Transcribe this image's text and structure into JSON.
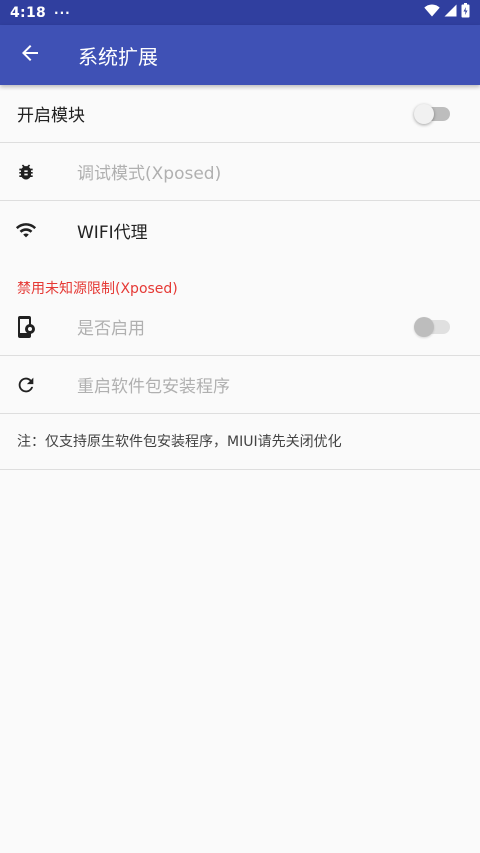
{
  "status_bar": {
    "time": "4:18",
    "dots": "···",
    "icons": [
      "wifi-icon",
      "signal-icon",
      "battery-icon"
    ]
  },
  "app_bar": {
    "title": "系统扩展",
    "back_icon": "arrow-back-icon"
  },
  "settings": {
    "enable_module": {
      "label": "开启模块",
      "checked": false
    },
    "debug_mode": {
      "label": "调试模式(Xposed)",
      "icon": "bug-icon"
    },
    "wifi_proxy": {
      "label": "WIFI代理",
      "icon": "wifi-icon"
    },
    "section_unknown_source": "禁用未知源限制(Xposed)",
    "enable_toggle": {
      "label": "是否启用",
      "icon": "phone-settings-icon",
      "checked": false
    },
    "restart_installer": {
      "label": "重启软件包安装程序",
      "icon": "refresh-icon"
    },
    "note": "注：仅支持原生软件包安装程序，MIUI请先关闭优化"
  },
  "colors": {
    "app_bar": "#3f51b5",
    "status_bar": "#303f9f",
    "section_header": "#e53935"
  }
}
